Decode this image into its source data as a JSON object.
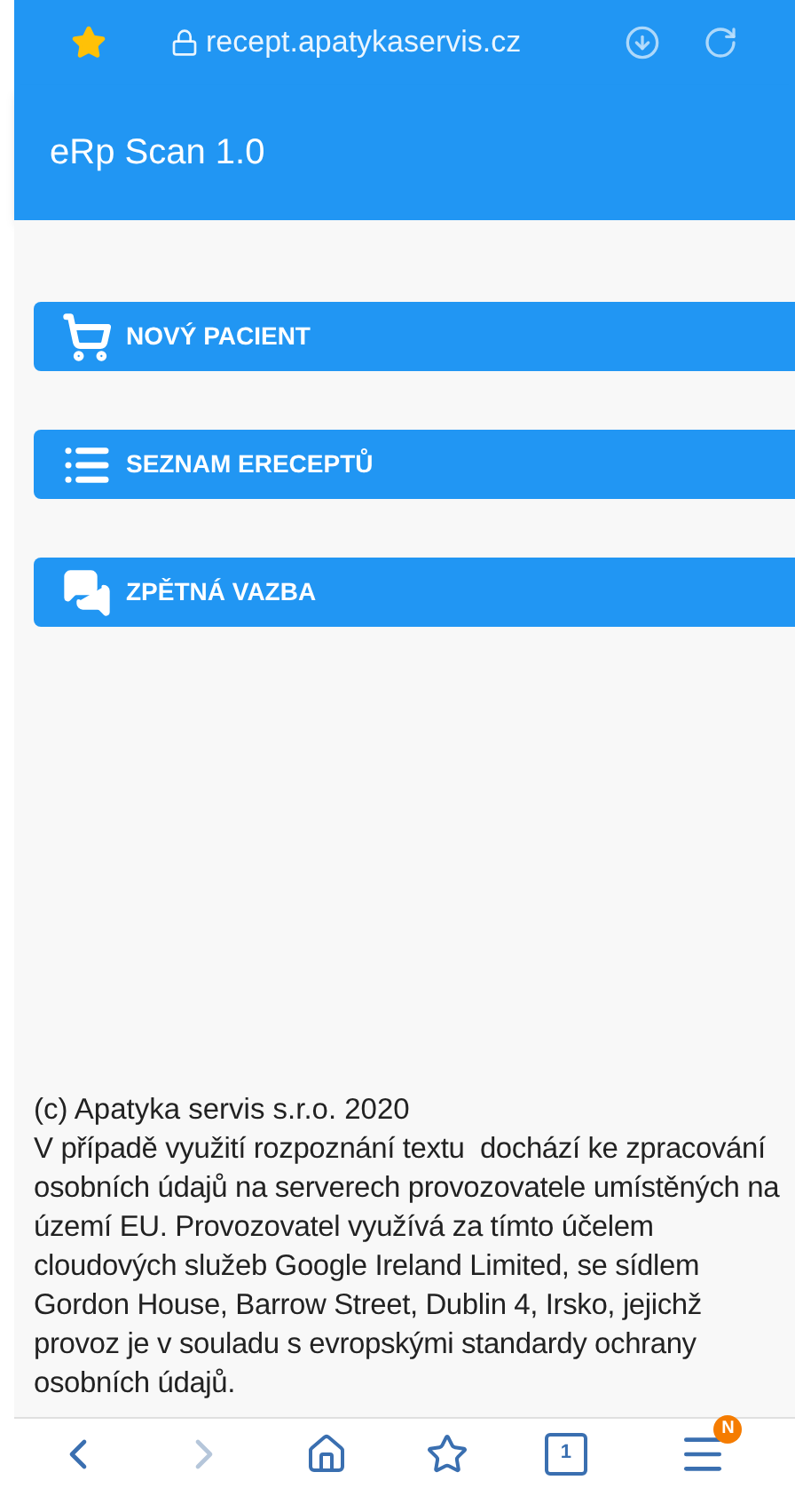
{
  "browser_bar": {
    "url": "recept.apatykaservis.cz",
    "bookmarked": true
  },
  "app_bar": {
    "title": "eRp Scan 1.0"
  },
  "menu_buttons": [
    {
      "kind": "cart",
      "label": "NOVÝ PACIENT"
    },
    {
      "kind": "list",
      "label": "SEZNAM ERECEPTŮ"
    },
    {
      "kind": "chat",
      "label": "ZPĚTNÁ VAZBA"
    }
  ],
  "footer": {
    "copyright": "(c) Apatyka servis s.r.o. 2020",
    "notice": "V případě využití rozpoznání textu  dochází ke zpracování osobních údajů na serverech provozovatele umístěných na území EU. Provozovatel využívá za tímto účelem cloudových služeb Google Ireland Limited, se sídlem  Gordon House, Barrow Street, Dublin 4, Irsko, jejichž provoz je v souladu s evropskými standardy ochrany osobních údajů."
  },
  "bottom_nav": [
    {
      "kind": "back",
      "disabled": false
    },
    {
      "kind": "forward",
      "disabled": true
    },
    {
      "kind": "home",
      "disabled": false
    },
    {
      "kind": "bookmarks",
      "disabled": false
    },
    {
      "kind": "tabs",
      "disabled": false,
      "count": "1"
    },
    {
      "kind": "menu",
      "disabled": false,
      "badge": "N"
    }
  ]
}
